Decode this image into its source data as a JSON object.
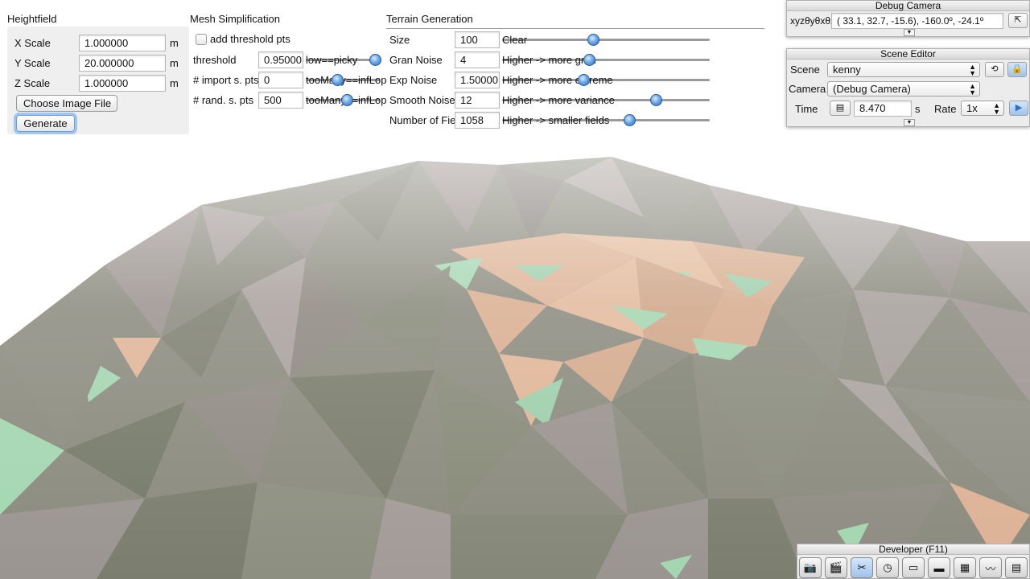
{
  "heightfield": {
    "title": "Heightfield",
    "rows": [
      {
        "label": "X Scale",
        "value": "1.000000",
        "unit": "m"
      },
      {
        "label": "Y Scale",
        "value": "20.000000",
        "unit": "m"
      },
      {
        "label": "Z Scale",
        "value": "1.000000",
        "unit": "m"
      }
    ],
    "choose_button": "Choose Image File",
    "generate_button": "Generate"
  },
  "mesh": {
    "title": "Mesh Simplification",
    "checkbox_label": "add threshold pts",
    "rows": [
      {
        "label": "threshold",
        "value": "0.95000",
        "hint": "low==picky",
        "level": 0.95
      },
      {
        "label": "# import s. pts",
        "value": "0",
        "hint": "tooMany==infLop",
        "level": 0.3
      },
      {
        "label": "# rand. s. pts",
        "value": "500",
        "hint": "tooMany==infLop",
        "level": 0.5
      }
    ]
  },
  "terrain": {
    "title": "Terrain Generation",
    "rows": [
      {
        "label": "Size",
        "value": "100",
        "hint": "Clear",
        "level": 0.37
      },
      {
        "label": "Gran Noise",
        "value": "4",
        "hint": "Higher -> more gran",
        "level": 0.33
      },
      {
        "label": "Exp Noise",
        "value": "1.50000",
        "hint": "Higher -> more extreme",
        "level": 0.31
      },
      {
        "label": "Smooth Noise",
        "value": "12",
        "hint": "Higher -> more variance",
        "level": 0.69
      },
      {
        "label": "Number of Fields",
        "value": "1058",
        "hint": "Higher -> smaller fields",
        "level": 0.5
      }
    ]
  },
  "debug_camera": {
    "title": "Debug Camera",
    "label": "xyzθyθxθz",
    "value": "( 33.1,  32.7, -15.6), -160.0º, -24.1º"
  },
  "scene_editor": {
    "title": "Scene Editor",
    "scene_label": "Scene",
    "scene_value": "kenny",
    "camera_label": "Camera",
    "camera_value": "(Debug Camera)",
    "time_label": "Time",
    "time_value": "8.470",
    "time_unit": "s",
    "rate_label": "Rate",
    "rate_value": "1x"
  },
  "developer": {
    "title": "Developer (F11)",
    "icons": [
      "camera-icon",
      "clapperboard-icon",
      "tools-icon",
      "clock-icon",
      "note-icon",
      "terminal-icon",
      "windows-icon",
      "profiler-icon",
      "document-icon"
    ]
  }
}
